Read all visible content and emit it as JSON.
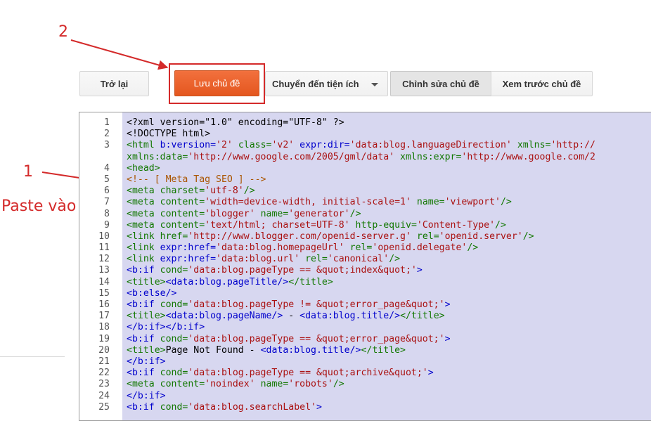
{
  "annotations": {
    "step2": "2",
    "step1": "1",
    "paste_label": "Paste vào"
  },
  "toolbar": {
    "back_label": "Trở lại",
    "save_label": "Lưu chủ đề",
    "goto_widget_label": "Chuyển đến tiện ích",
    "edit_theme_label": "Chỉnh sửa chủ đề",
    "preview_theme_label": "Xem trước chủ đề"
  },
  "colors": {
    "annotation_red": "#d42a2a",
    "save_button_orange": "#e9602a",
    "code_selection_bg": "#d7d7f0",
    "tag_green": "#117700",
    "attr_blue": "#0000cc",
    "value_red": "#aa1111",
    "comment_brown": "#aa5500"
  },
  "icons": {
    "dropdown": "chevron-down-icon"
  },
  "editor": {
    "lines": [
      {
        "n": "1",
        "segs": [
          {
            "t": "<?xml version=\"1.0\" encoding=\"UTF-8\" ?>",
            "c": "plain"
          }
        ]
      },
      {
        "n": "2",
        "segs": [
          {
            "t": "<!DOCTYPE html>",
            "c": "plain"
          }
        ]
      },
      {
        "n": "3",
        "segs": [
          {
            "t": "<html ",
            "c": "tag"
          },
          {
            "t": "b:version=",
            "c": "at"
          },
          {
            "t": "'2'",
            "c": "val"
          },
          {
            "t": " class=",
            "c": "tag"
          },
          {
            "t": "'v2'",
            "c": "val"
          },
          {
            "t": " expr:dir=",
            "c": "at"
          },
          {
            "t": "'data:blog.languageDirection'",
            "c": "val"
          },
          {
            "t": " xmlns=",
            "c": "tag"
          },
          {
            "t": "'http://",
            "c": "val"
          }
        ]
      },
      {
        "n": "",
        "segs": [
          {
            "t": "xmlns:data=",
            "c": "tag"
          },
          {
            "t": "'http://www.google.com/2005/gml/data'",
            "c": "val"
          },
          {
            "t": " xmlns:expr=",
            "c": "tag"
          },
          {
            "t": "'http://www.google.com/2",
            "c": "val"
          }
        ]
      },
      {
        "n": "4",
        "segs": [
          {
            "t": "<head>",
            "c": "tag"
          }
        ]
      },
      {
        "n": "5",
        "segs": [
          {
            "t": "<!-- [ Meta Tag SEO ] -->",
            "c": "cmt"
          }
        ]
      },
      {
        "n": "6",
        "segs": [
          {
            "t": "<meta ",
            "c": "tag"
          },
          {
            "t": "charset=",
            "c": "tag"
          },
          {
            "t": "'utf-8'",
            "c": "val"
          },
          {
            "t": "/>",
            "c": "tag"
          }
        ]
      },
      {
        "n": "7",
        "segs": [
          {
            "t": "<meta ",
            "c": "tag"
          },
          {
            "t": "content=",
            "c": "tag"
          },
          {
            "t": "'width=device-width, initial-scale=1'",
            "c": "val"
          },
          {
            "t": " name=",
            "c": "tag"
          },
          {
            "t": "'viewport'",
            "c": "val"
          },
          {
            "t": "/>",
            "c": "tag"
          }
        ]
      },
      {
        "n": "8",
        "segs": [
          {
            "t": "<meta ",
            "c": "tag"
          },
          {
            "t": "content=",
            "c": "tag"
          },
          {
            "t": "'blogger'",
            "c": "val"
          },
          {
            "t": " name=",
            "c": "tag"
          },
          {
            "t": "'generator'",
            "c": "val"
          },
          {
            "t": "/>",
            "c": "tag"
          }
        ]
      },
      {
        "n": "9",
        "segs": [
          {
            "t": "<meta ",
            "c": "tag"
          },
          {
            "t": "content=",
            "c": "tag"
          },
          {
            "t": "'text/html; charset=UTF-8'",
            "c": "val"
          },
          {
            "t": " http-equiv=",
            "c": "tag"
          },
          {
            "t": "'Content-Type'",
            "c": "val"
          },
          {
            "t": "/>",
            "c": "tag"
          }
        ]
      },
      {
        "n": "10",
        "segs": [
          {
            "t": "<link ",
            "c": "tag"
          },
          {
            "t": "href=",
            "c": "tag"
          },
          {
            "t": "'http://www.blogger.com/openid-server.g'",
            "c": "val"
          },
          {
            "t": " rel=",
            "c": "tag"
          },
          {
            "t": "'openid.server'",
            "c": "val"
          },
          {
            "t": "/>",
            "c": "tag"
          }
        ]
      },
      {
        "n": "11",
        "segs": [
          {
            "t": "<link ",
            "c": "tag"
          },
          {
            "t": "expr:href=",
            "c": "at"
          },
          {
            "t": "'data:blog.homepageUrl'",
            "c": "val"
          },
          {
            "t": " rel=",
            "c": "tag"
          },
          {
            "t": "'openid.delegate'",
            "c": "val"
          },
          {
            "t": "/>",
            "c": "tag"
          }
        ]
      },
      {
        "n": "12",
        "segs": [
          {
            "t": "<link ",
            "c": "tag"
          },
          {
            "t": "expr:href=",
            "c": "at"
          },
          {
            "t": "'data:blog.url'",
            "c": "val"
          },
          {
            "t": " rel=",
            "c": "tag"
          },
          {
            "t": "'canonical'",
            "c": "val"
          },
          {
            "t": "/>",
            "c": "tag"
          }
        ]
      },
      {
        "n": "13",
        "segs": [
          {
            "t": "<b:if ",
            "c": "at"
          },
          {
            "t": "cond=",
            "c": "tag"
          },
          {
            "t": "'data:blog.pageType == &quot;index&quot;'",
            "c": "val"
          },
          {
            "t": ">",
            "c": "at"
          }
        ]
      },
      {
        "n": "14",
        "segs": [
          {
            "t": "<title>",
            "c": "tag"
          },
          {
            "t": "<data:blog.pageTitle/>",
            "c": "at"
          },
          {
            "t": "</title>",
            "c": "tag"
          }
        ]
      },
      {
        "n": "15",
        "segs": [
          {
            "t": "<b:else/>",
            "c": "at"
          }
        ]
      },
      {
        "n": "16",
        "segs": [
          {
            "t": "<b:if ",
            "c": "at"
          },
          {
            "t": "cond=",
            "c": "tag"
          },
          {
            "t": "'data:blog.pageType != &quot;error_page&quot;'",
            "c": "val"
          },
          {
            "t": ">",
            "c": "at"
          }
        ]
      },
      {
        "n": "17",
        "segs": [
          {
            "t": "<title>",
            "c": "tag"
          },
          {
            "t": "<data:blog.pageName/>",
            "c": "at"
          },
          {
            "t": " - ",
            "c": "plain"
          },
          {
            "t": "<data:blog.title/>",
            "c": "at"
          },
          {
            "t": "</title>",
            "c": "tag"
          }
        ]
      },
      {
        "n": "18",
        "segs": [
          {
            "t": "</b:if></b:if>",
            "c": "at"
          }
        ]
      },
      {
        "n": "19",
        "segs": [
          {
            "t": "<b:if ",
            "c": "at"
          },
          {
            "t": "cond=",
            "c": "tag"
          },
          {
            "t": "'data:blog.pageType == &quot;error_page&quot;'",
            "c": "val"
          },
          {
            "t": ">",
            "c": "at"
          }
        ]
      },
      {
        "n": "20",
        "segs": [
          {
            "t": "<title>",
            "c": "tag"
          },
          {
            "t": "Page Not Found - ",
            "c": "plain"
          },
          {
            "t": "<data:blog.title/>",
            "c": "at"
          },
          {
            "t": "</title>",
            "c": "tag"
          }
        ]
      },
      {
        "n": "21",
        "segs": [
          {
            "t": "</b:if>",
            "c": "at"
          }
        ]
      },
      {
        "n": "22",
        "segs": [
          {
            "t": "<b:if ",
            "c": "at"
          },
          {
            "t": "cond=",
            "c": "tag"
          },
          {
            "t": "'data:blog.pageType == &quot;archive&quot;'",
            "c": "val"
          },
          {
            "t": ">",
            "c": "at"
          }
        ]
      },
      {
        "n": "23",
        "segs": [
          {
            "t": "<meta ",
            "c": "tag"
          },
          {
            "t": "content=",
            "c": "tag"
          },
          {
            "t": "'noindex'",
            "c": "val"
          },
          {
            "t": " name=",
            "c": "tag"
          },
          {
            "t": "'robots'",
            "c": "val"
          },
          {
            "t": "/>",
            "c": "tag"
          }
        ]
      },
      {
        "n": "24",
        "segs": [
          {
            "t": "</b:if>",
            "c": "at"
          }
        ]
      },
      {
        "n": "25",
        "segs": [
          {
            "t": "<b:if ",
            "c": "at"
          },
          {
            "t": "cond=",
            "c": "tag"
          },
          {
            "t": "'data:blog.searchLabel'",
            "c": "val"
          },
          {
            "t": ">",
            "c": "at"
          }
        ]
      }
    ]
  }
}
